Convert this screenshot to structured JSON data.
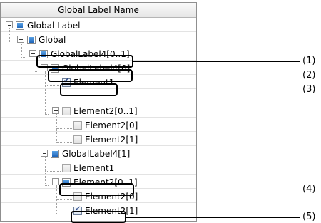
{
  "header": {
    "title": "Global Label Name"
  },
  "tree": [
    {
      "label": "Global Label",
      "icon": "folder-icon",
      "checked": null
    },
    {
      "label": "Global",
      "icon": "folder-icon",
      "checked": null
    },
    {
      "label": "GlobalLabel4[0..1]",
      "icon": "folder-icon",
      "checked": null
    },
    {
      "label": "GlobalLabel4[0]",
      "icon": "folder-icon",
      "checked": null
    },
    {
      "label": "Element1",
      "icon": "checkbox-checked-icon",
      "checked": true
    },
    {
      "label": "Element2[0..1]",
      "icon": "checkbox-icon",
      "checked": false
    },
    {
      "label": "Element2[0]",
      "icon": "checkbox-icon",
      "checked": false
    },
    {
      "label": "Element2[1]",
      "icon": "checkbox-icon",
      "checked": false
    },
    {
      "label": "GlobalLabel4[1]",
      "icon": "folder-icon",
      "checked": null
    },
    {
      "label": "Element1",
      "icon": "checkbox-icon",
      "checked": false
    },
    {
      "label": "Element2[0..1]",
      "icon": "folder-icon",
      "checked": null
    },
    {
      "label": "Element2[0]",
      "icon": "checkbox-icon",
      "checked": false
    },
    {
      "label": "Element2[1]",
      "icon": "checkbox-checked-icon",
      "checked": true
    }
  ],
  "callouts": [
    "(1)",
    "(2)",
    "(3)",
    "(4)",
    "(5)"
  ]
}
